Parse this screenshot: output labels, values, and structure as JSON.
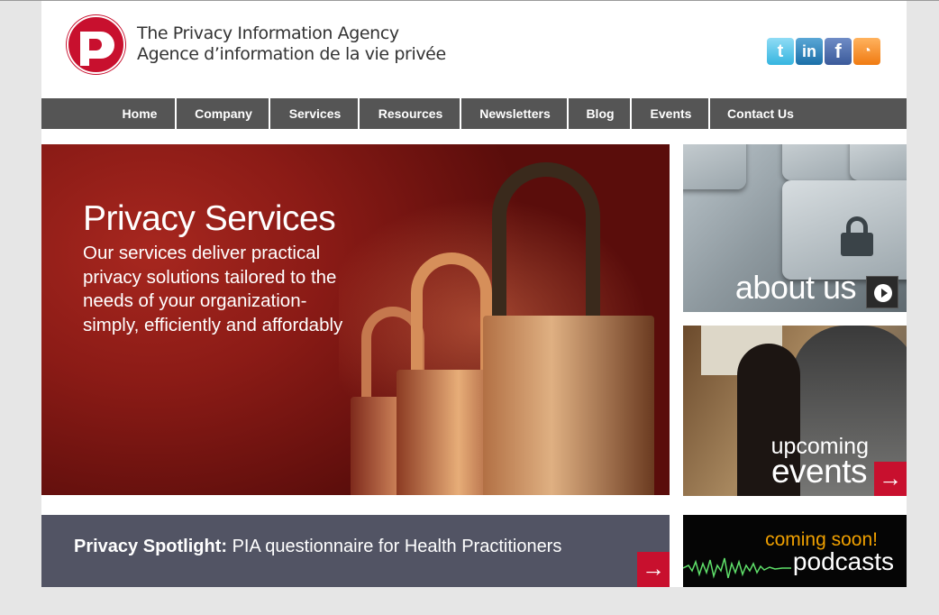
{
  "header": {
    "title_en": "The Privacy Information Agency",
    "title_fr": "Agence d’information de la vie privée",
    "logo_icon": "pia-logo-icon",
    "social": [
      {
        "name": "twitter-icon",
        "glyph": "t"
      },
      {
        "name": "linkedin-icon",
        "glyph": "in"
      },
      {
        "name": "facebook-icon",
        "glyph": "f"
      },
      {
        "name": "rss-icon",
        "glyph": "◔"
      }
    ]
  },
  "nav": {
    "items": [
      "Home",
      "Company",
      "Services",
      "Resources",
      "Newsletters",
      "Blog",
      "Events",
      "Contact Us"
    ]
  },
  "hero": {
    "title": "Privacy Services",
    "text": "Our services deliver practical privacy solutions tailored to the needs of your organization- simply, efficiently and affordably"
  },
  "tiles": {
    "about": {
      "label": "about us"
    },
    "events": {
      "line1": "upcoming",
      "line2": "events"
    },
    "podcasts": {
      "line1": "coming soon!",
      "line2": "podcasts"
    }
  },
  "spotlight": {
    "label": "Privacy Spotlight:",
    "text": "PIA questionnaire for Health Practitioners"
  },
  "colors": {
    "accent": "#c8102e",
    "nav_bg": "#555555",
    "spotlight_bg": "#525464",
    "podcast_orange": "#f0a000"
  },
  "icons": {
    "arrow": "→",
    "play": "play-icon"
  }
}
